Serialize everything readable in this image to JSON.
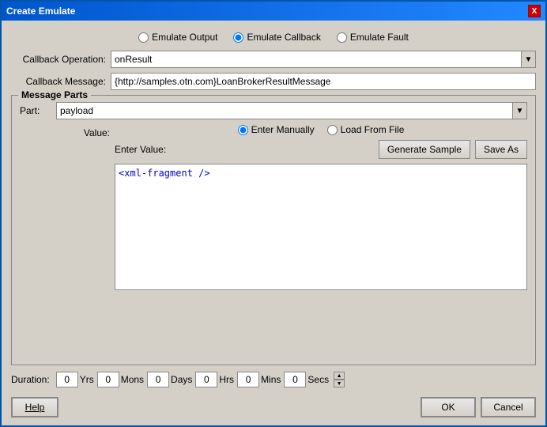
{
  "window": {
    "title": "Create Emulate",
    "close_label": "X"
  },
  "emulate_options": {
    "output_label": "Emulate Output",
    "callback_label": "Emulate Callback",
    "fault_label": "Emulate Fault",
    "selected": "callback"
  },
  "callback_operation": {
    "label": "Callback Operation:",
    "value": "onResult"
  },
  "callback_message": {
    "label": "Callback Message:",
    "value": "{http://samples.otn.com}LoanBrokerResultMessage"
  },
  "message_parts": {
    "legend": "Message Parts",
    "part_label": "Part:",
    "part_value": "payload",
    "value_label": "Value:",
    "enter_manually_label": "Enter Manually",
    "load_from_file_label": "Load From File",
    "enter_value_label": "Enter Value:",
    "generate_sample_label": "Generate Sample",
    "save_as_label": "Save As",
    "xml_content": "<xml-fragment />"
  },
  "duration": {
    "label": "Duration:",
    "fields": [
      {
        "value": "0",
        "unit": "Yrs"
      },
      {
        "value": "0",
        "unit": "Mons"
      },
      {
        "value": "0",
        "unit": "Days"
      },
      {
        "value": "0",
        "unit": "Hrs"
      },
      {
        "value": "0",
        "unit": "Mins"
      },
      {
        "value": "0",
        "unit": "Secs"
      }
    ]
  },
  "buttons": {
    "help_label": "Help",
    "ok_label": "OK",
    "cancel_label": "Cancel"
  }
}
